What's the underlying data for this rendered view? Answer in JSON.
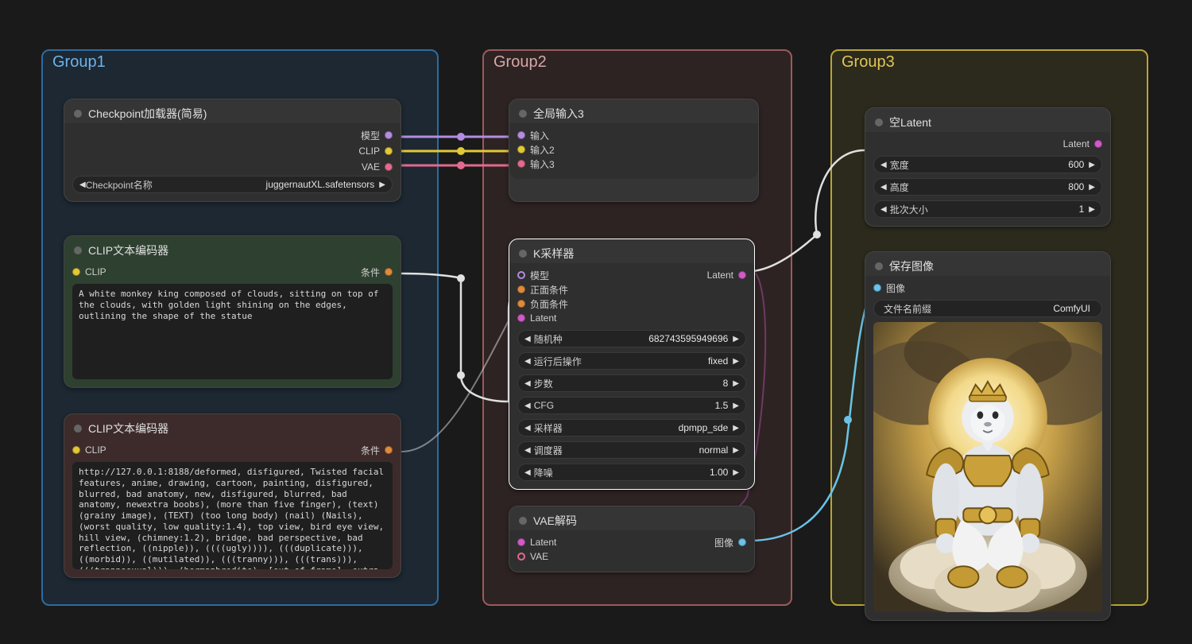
{
  "groups": {
    "g1": "Group1",
    "g2": "Group2",
    "g3": "Group3"
  },
  "checkpoint": {
    "title": "Checkpoint加载器(简易)",
    "out_model": "模型",
    "out_clip": "CLIP",
    "out_vae": "VAE",
    "combo_label": "Checkpoint名称",
    "combo_value": "juggernautXL.safetensors"
  },
  "pos_encoder": {
    "title": "CLIP文本编码器",
    "in_clip": "CLIP",
    "out_cond": "条件",
    "text": "A white monkey king composed of clouds, sitting on top of the clouds, with golden light shining on the edges, outlining the shape of the statue"
  },
  "neg_encoder": {
    "title": "CLIP文本编码器",
    "in_clip": "CLIP",
    "out_cond": "条件",
    "text": "http://127.0.0.1:8188/deformed, disfigured, Twisted facial features, anime, drawing, cartoon, painting, disfigured, blurred, bad anatomy, new, disfigured, blurred, bad anatomy, newextra boobs), (more than five finger), (text) (grainy image), (TEXT) (too long body) (nail) (Nails), (worst quality, low quality:1.4), top view, bird eye view, hill view, (chimney:1.2), bridge, bad perspective, bad reflection, ((nipple)), ((((ugly)))), (((duplicate))), ((morbid)), ((mutilated)), (((tranny))), (((trans))), (((trannsexual))), (hermaphrodite), [out of frame], extra fingers, mutated hands, ((poorly drawn hands)), ((poorly drawn face)), (((mutation))), (((deformed))), ((ugly)), blurry,"
  },
  "global_input": {
    "title": "全局输入3",
    "in1": "输入",
    "in2": "输入2",
    "in3": "输入3"
  },
  "ksampler": {
    "title": "K采样器",
    "in_model": "模型",
    "in_pos": "正面条件",
    "in_neg": "负面条件",
    "in_latent": "Latent",
    "out_latent": "Latent",
    "params": [
      {
        "label": "随机种",
        "value": "682743595949696"
      },
      {
        "label": "运行后操作",
        "value": "fixed"
      },
      {
        "label": "步数",
        "value": "8"
      },
      {
        "label": "CFG",
        "value": "1.5"
      },
      {
        "label": "采样器",
        "value": "dpmpp_sde"
      },
      {
        "label": "调度器",
        "value": "normal"
      },
      {
        "label": "降噪",
        "value": "1.00"
      }
    ]
  },
  "vae_decode": {
    "title": "VAE解码",
    "in_latent": "Latent",
    "in_vae": "VAE",
    "out_image": "图像"
  },
  "empty_latent": {
    "title": "空Latent",
    "out_latent": "Latent",
    "params": [
      {
        "label": "宽度",
        "value": "600"
      },
      {
        "label": "高度",
        "value": "800"
      },
      {
        "label": "批次大小",
        "value": "1"
      }
    ]
  },
  "save_image": {
    "title": "保存图像",
    "in_image": "图像",
    "prefix_label": "文件名前缀",
    "prefix_value": "ComfyUI"
  }
}
